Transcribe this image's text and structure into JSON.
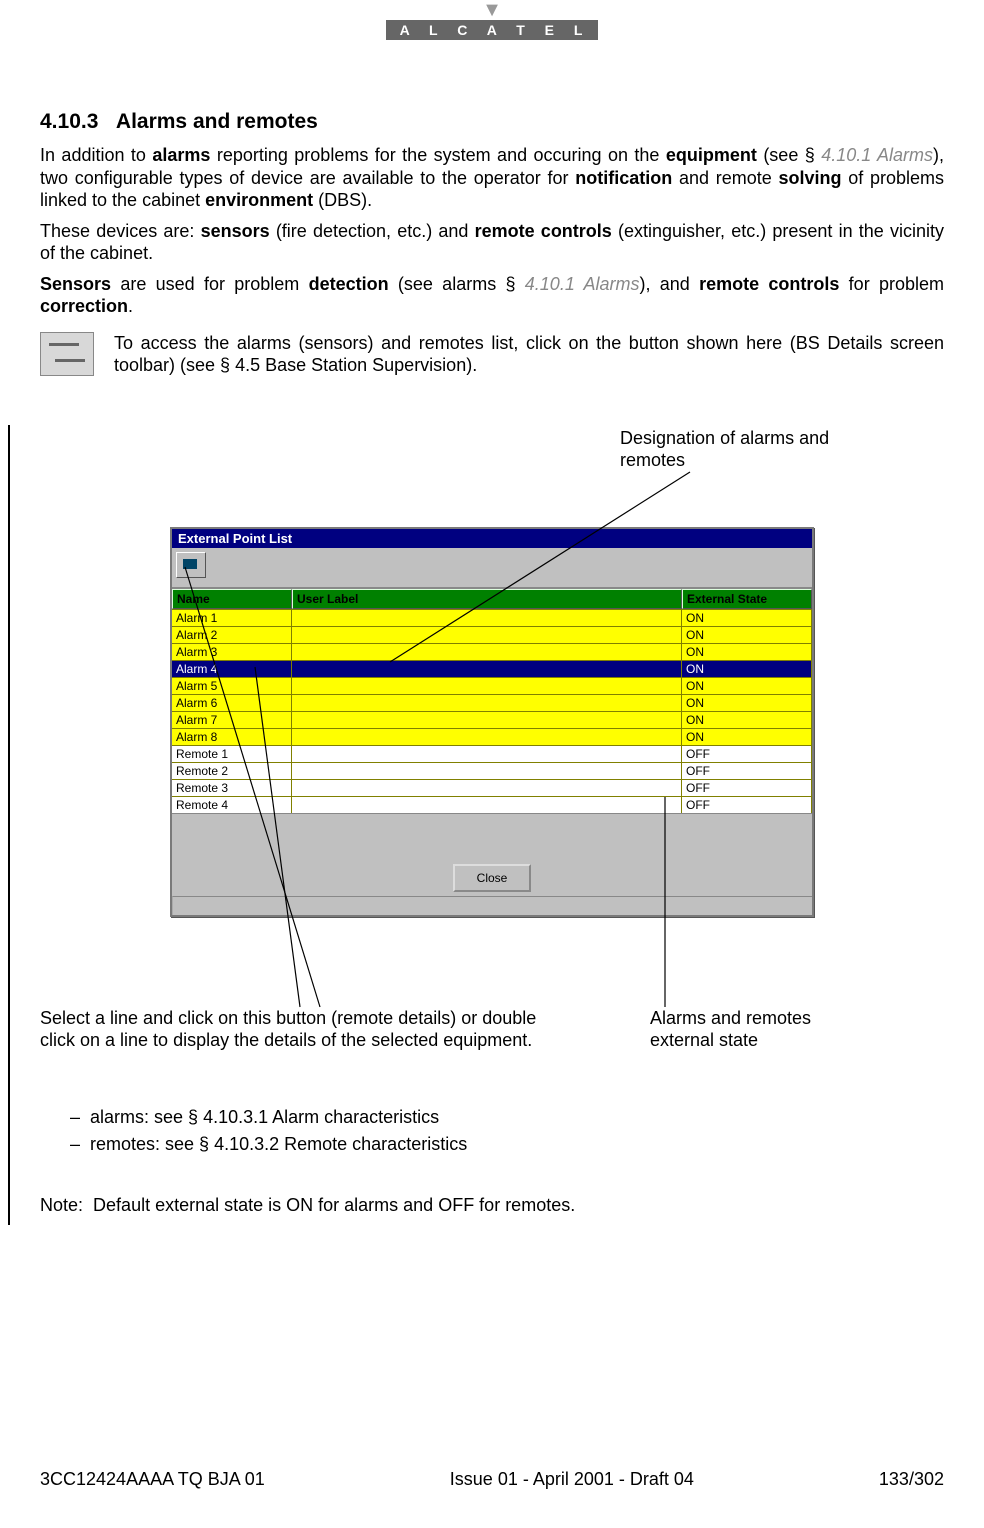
{
  "logo": {
    "brand": "A L C A T E L"
  },
  "section": {
    "number": "4.10.3",
    "title": "Alarms and remotes"
  },
  "paragraphs": {
    "p1_a": "In addition to ",
    "p1_b": "alarms",
    "p1_c": " reporting problems for the system and occuring on the ",
    "p1_d": "equipment",
    "p1_e": " (see § ",
    "p1_ref1": "4.10.1 Alarms",
    "p1_f": "), two configurable types of device are available to the operator for ",
    "p1_g": "notification",
    "p1_h": " and remote ",
    "p1_i": "solving",
    "p1_j": " of problems linked to the cabinet ",
    "p1_k": "environment",
    "p1_l": " (DBS).",
    "p2_a": "These devices are: ",
    "p2_b": "sensors",
    "p2_c": " (fire detection, etc.) and ",
    "p2_d": "remote controls",
    "p2_e": " (extinguisher, etc.) present in the vicinity of the cabinet.",
    "p3_a": "Sensors",
    "p3_b": " are used for problem ",
    "p3_c": "detection",
    "p3_d": " (see alarms § ",
    "p3_ref": "4.10.1 Alarms",
    "p3_e": "), and ",
    "p3_f": "remote controls",
    "p3_g": " for problem ",
    "p3_h": "correction",
    "p3_i": ".",
    "iconnote_a": "To access the alarms (sensors) and remotes list, click on the button shown here (",
    "iconnote_b": "BS Details",
    "iconnote_c": " screen toolbar) (see § ",
    "iconnote_ref": "4.5 Base Station Supervision",
    "iconnote_d": ")."
  },
  "callouts": {
    "designation": "Designation of alarms and remotes",
    "select_a": "Select a line and click on this button (remote details) or double click on a line to display the ",
    "select_b": "details",
    "select_c": " of the selected equipment.",
    "extstate": "Alarms and remotes external state"
  },
  "window": {
    "title": "External Point List",
    "columns": {
      "name": "Name",
      "label": "User Label",
      "state": "External State"
    },
    "rows": [
      {
        "name": "Alarm 1",
        "label": "",
        "state": "ON",
        "cls": "on"
      },
      {
        "name": "Alarm 2",
        "label": "",
        "state": "ON",
        "cls": "on"
      },
      {
        "name": "Alarm 3",
        "label": "",
        "state": "ON",
        "cls": "on"
      },
      {
        "name": "Alarm 4",
        "label": "",
        "state": "ON",
        "cls": "sel"
      },
      {
        "name": "Alarm 5",
        "label": "",
        "state": "ON",
        "cls": "on"
      },
      {
        "name": "Alarm 6",
        "label": "",
        "state": "ON",
        "cls": "on"
      },
      {
        "name": "Alarm 7",
        "label": "",
        "state": "ON",
        "cls": "on"
      },
      {
        "name": "Alarm 8",
        "label": "",
        "state": "ON",
        "cls": "on"
      },
      {
        "name": "Remote 1",
        "label": "",
        "state": "OFF",
        "cls": "off"
      },
      {
        "name": "Remote 2",
        "label": "",
        "state": "OFF",
        "cls": "off"
      },
      {
        "name": "Remote 3",
        "label": "",
        "state": "OFF",
        "cls": "off"
      },
      {
        "name": "Remote 4",
        "label": "",
        "state": "OFF",
        "cls": "off"
      }
    ],
    "close": "Close"
  },
  "list": {
    "i1_a": "alarms: see § ",
    "i1_ref": "4.10.3.1 Alarm characteristics",
    "i2_a": "remotes: see § ",
    "i2_ref": "4.10.3.2 Remote characteristics"
  },
  "note": {
    "label": "Note:",
    "text": "Default external state is ON for alarms and OFF for remotes."
  },
  "footer": {
    "left": "3CC12424AAAA TQ BJA 01",
    "center": "Issue 01 - April 2001 - Draft 04",
    "page_current": "133",
    "page_total": "/302"
  }
}
